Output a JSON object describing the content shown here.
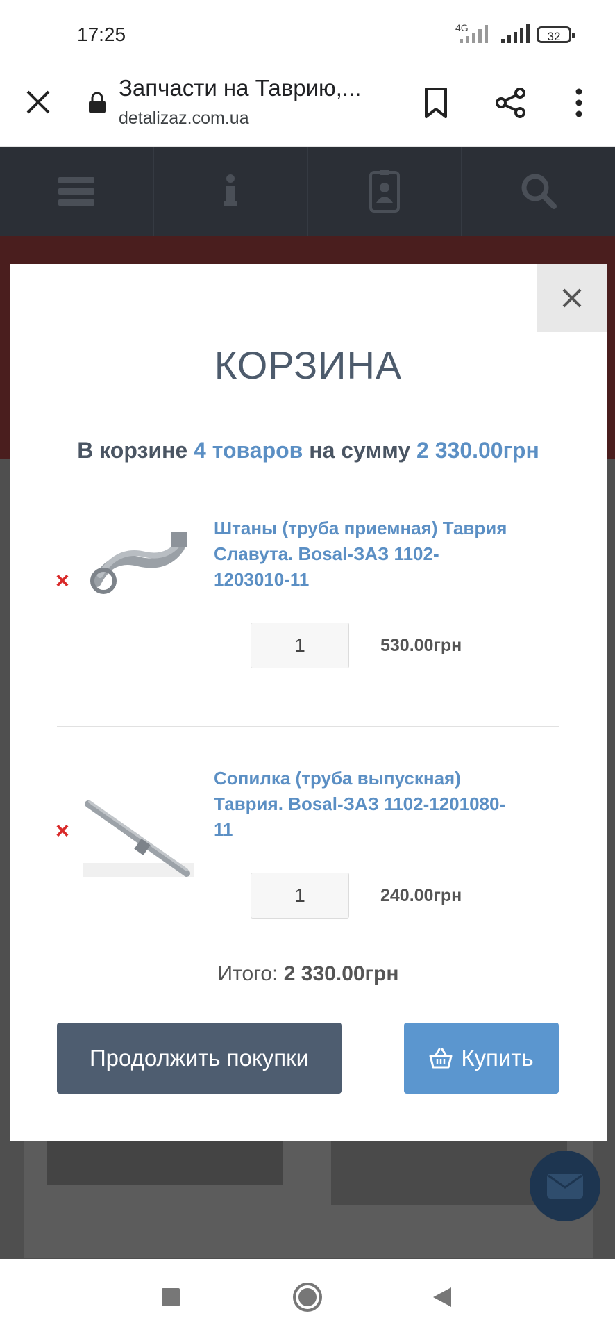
{
  "status_bar": {
    "time": "17:25",
    "network": "4G",
    "battery": "32"
  },
  "browser": {
    "title": "Запчасти на Таврию,...",
    "url": "detalizaz.com.ua"
  },
  "cart": {
    "heading": "КОРЗИНА",
    "summary_prefix": "В корзине",
    "summary_count": "4 товаров",
    "summary_middle": "на сумму",
    "summary_amount": "2 330.00грн",
    "items": [
      {
        "name": "Штаны (труба приемная) Таврия Славута. Bosal-ЗАЗ 1102-1203010-11",
        "quantity": "1",
        "price": "530.00грн"
      },
      {
        "name": "Сопилка (труба выпускная) Таврия. Bosal-ЗАЗ 1102-1201080-11",
        "quantity": "1",
        "price": "240.00грн"
      }
    ],
    "total_label": "Итого:",
    "total_value": "2 330.00грн",
    "continue_label": "Продолжить покупки",
    "buy_label": "Купить",
    "remove_symbol": "×"
  },
  "colors": {
    "accent": "#5b8fc4",
    "continue_button": "#4e5d70",
    "buy_button": "#5b96cf",
    "remove": "#d92a2a",
    "site_nav": "#2b2f36"
  }
}
